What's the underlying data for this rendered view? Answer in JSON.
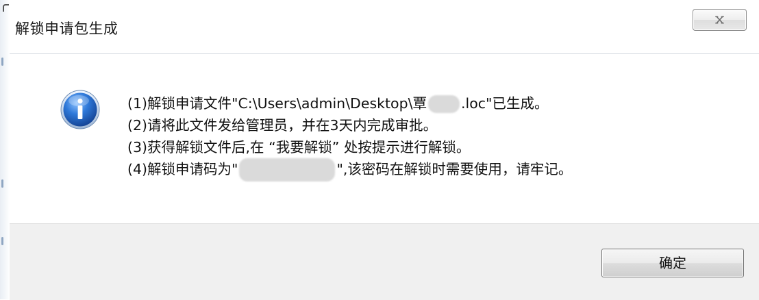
{
  "dialog": {
    "title": "解锁申请包生成"
  },
  "message": {
    "line1_prefix": "(1)解锁申请文件\"C:\\Users\\admin\\Desktop\\覃",
    "line1_suffix": ".loc\"已生成。",
    "line2": "(2)请将此文件发给管理员，并在3天内完成审批。",
    "line3": "(3)获得解锁文件后,在 “我要解锁” 处按提示进行解锁。",
    "line4_prefix": "(4)解锁申请码为\"",
    "line4_suffix": "\",该密码在解锁时需要使用，请牢记。"
  },
  "buttons": {
    "ok_label": "确定"
  },
  "icons": {
    "info": "info-icon",
    "close": "close-icon"
  },
  "colors": {
    "info_blue": "#1b5fbf",
    "footer_bg": "#f0f0f0"
  }
}
